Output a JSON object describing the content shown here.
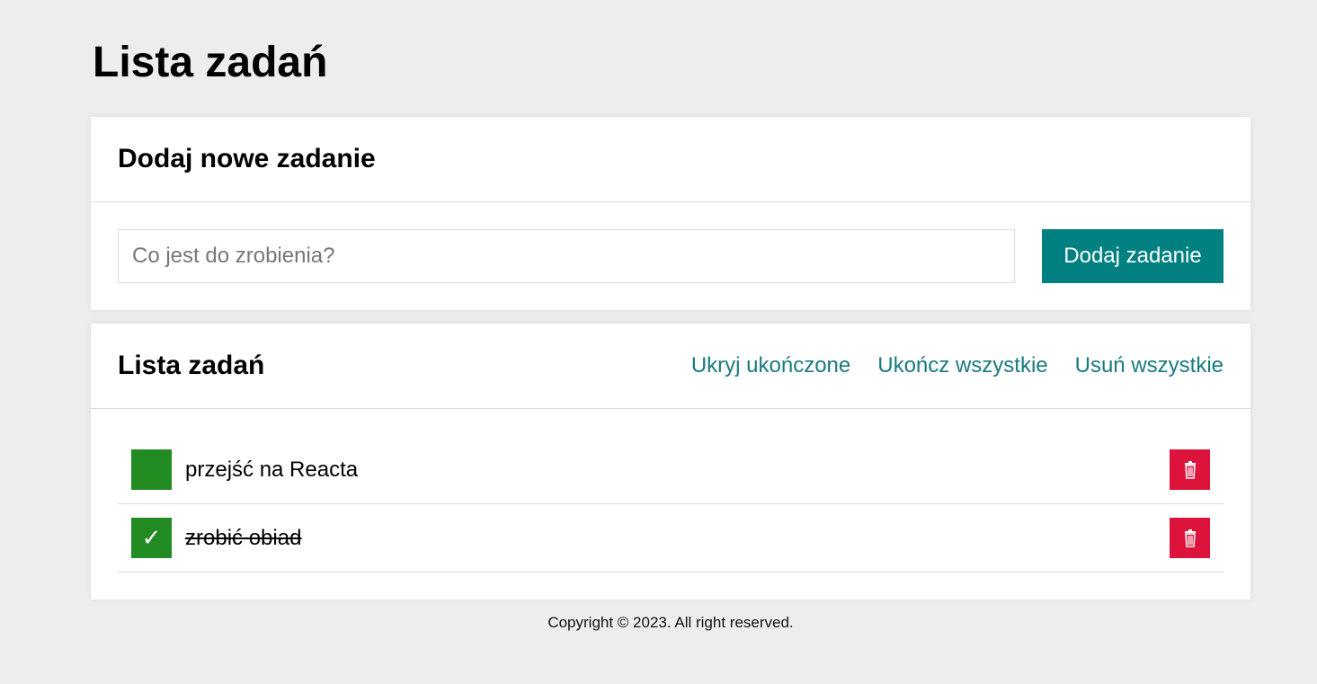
{
  "page_title": "Lista zadań",
  "form_section": {
    "title": "Dodaj nowe zadanie",
    "input_placeholder": "Co jest do zrobienia?",
    "input_value": "",
    "add_button_label": "Dodaj zadanie"
  },
  "list_section": {
    "title": "Lista zadań",
    "actions": {
      "hide_completed": "Ukryj ukończone",
      "complete_all": "Ukończ wszystkie",
      "delete_all": "Usuń wszystkie"
    },
    "tasks": [
      {
        "text": "przejść na Reacta",
        "done": false
      },
      {
        "text": "zrobić obiad",
        "done": true
      }
    ],
    "icons": {
      "check": "✓",
      "delete": "trash-icon"
    }
  },
  "footer": {
    "text": "Copyright © 2023. All right reserved."
  },
  "colors": {
    "background": "#ededed",
    "accent_teal": "#008080",
    "link_teal": "#1a7a80",
    "toggle_green": "#228b22",
    "delete_red": "#dc143c"
  }
}
